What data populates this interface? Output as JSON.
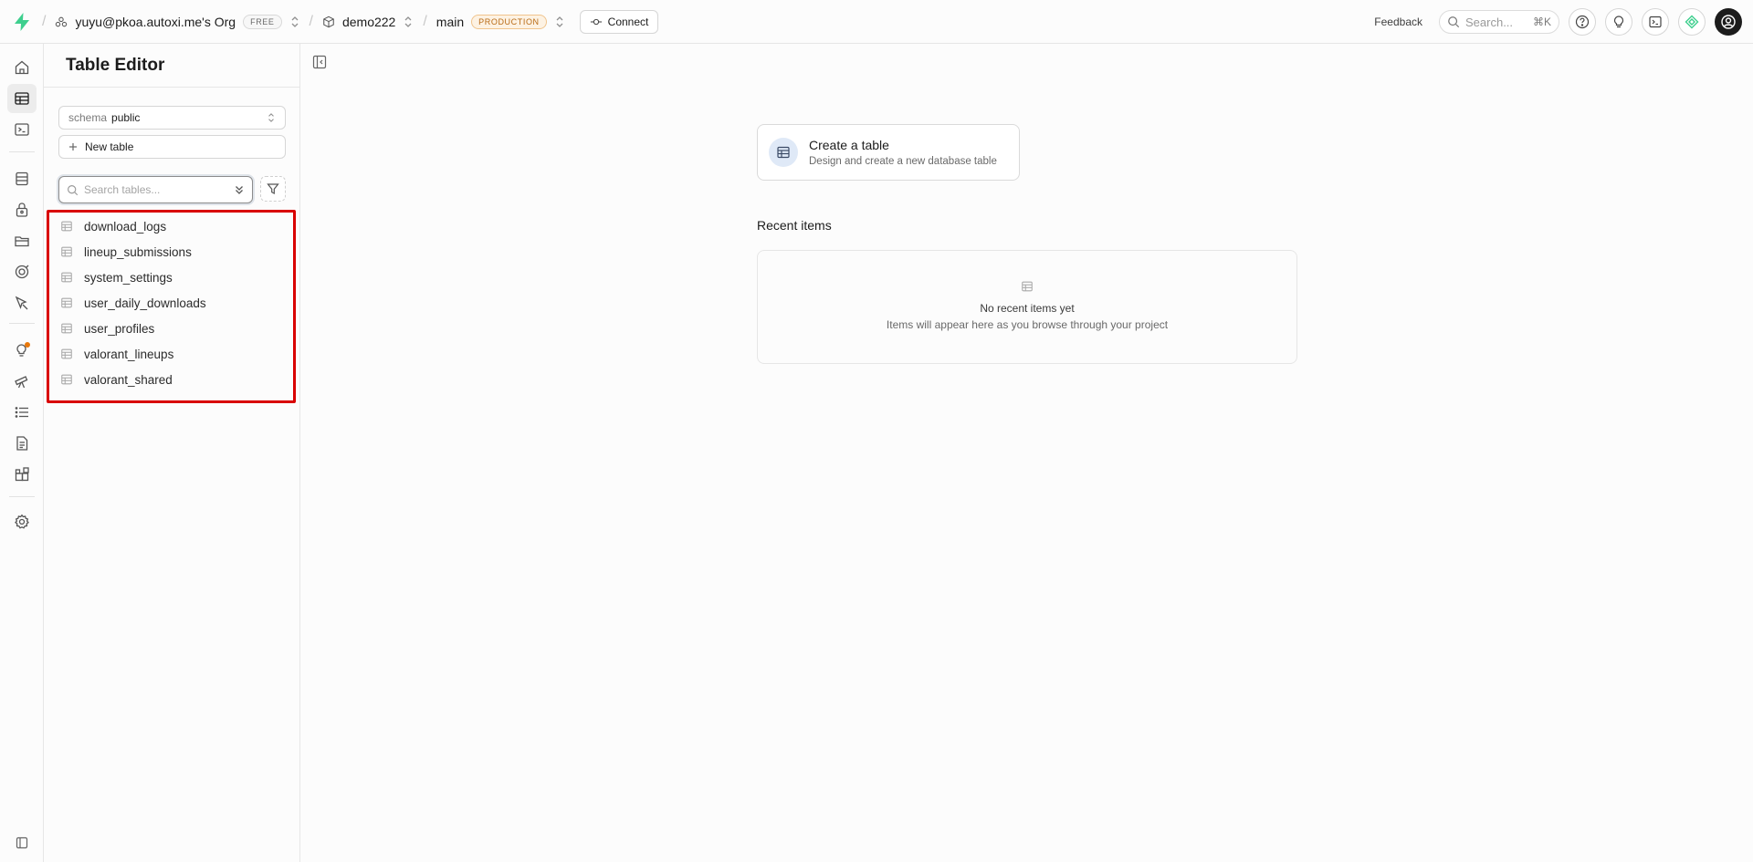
{
  "topbar": {
    "org_name": "yuyu@pkoa.autoxi.me's Org",
    "org_plan": "FREE",
    "project_name": "demo222",
    "branch_name": "main",
    "branch_env": "PRODUCTION",
    "connect_label": "Connect",
    "feedback_label": "Feedback",
    "search_placeholder": "Search...",
    "search_shortcut": "⌘K"
  },
  "rail": {
    "items": [
      "home-icon",
      "table-editor-icon",
      "sql-editor-icon",
      "database-icon",
      "auth-icon",
      "storage-icon",
      "realtime-icon",
      "edge-functions-icon",
      "advisors-icon",
      "reports-icon",
      "logs-icon",
      "api-docs-icon",
      "integrations-icon",
      "settings-icon",
      "collapse-rail-icon"
    ],
    "active": "table-editor-icon"
  },
  "sidebar": {
    "title": "Table Editor",
    "schema_label": "schema",
    "schema_value": "public",
    "new_table_label": "New table",
    "search_placeholder": "Search tables...",
    "tables": [
      "download_logs",
      "lineup_submissions",
      "system_settings",
      "user_daily_downloads",
      "user_profiles",
      "valorant_lineups",
      "valorant_shared"
    ]
  },
  "main": {
    "create_title": "Create a table",
    "create_subtitle": "Design and create a new database table",
    "recent_title": "Recent items",
    "recent_empty_title": "No recent items yet",
    "recent_empty_subtitle": "Items will appear here as you browse through your project"
  },
  "colors": {
    "accent_green": "#3ecf8e",
    "highlight_red": "#d90000",
    "production_orange": "#b86a14"
  }
}
